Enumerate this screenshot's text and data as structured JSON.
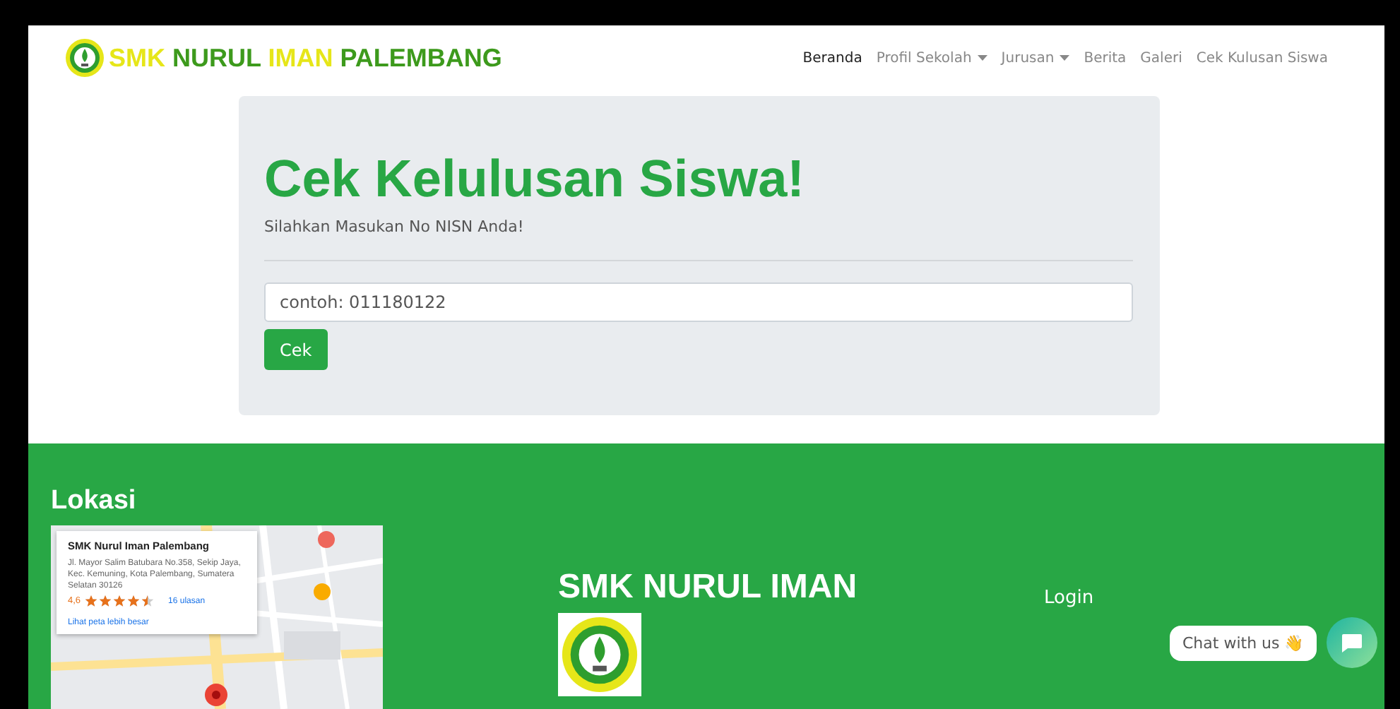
{
  "brand": {
    "parts": [
      {
        "text": "SMK",
        "color": "#e6e619"
      },
      {
        "text": "NURUL",
        "color": "#3d9a1c"
      },
      {
        "text": "IMAN",
        "color": "#e6e619"
      },
      {
        "text": "PALEMBANG",
        "color": "#3d9a1c"
      }
    ]
  },
  "nav": [
    {
      "label": "Beranda",
      "selected": true,
      "dropdown": false
    },
    {
      "label": "Profil Sekolah",
      "selected": false,
      "dropdown": true
    },
    {
      "label": "Jurusan",
      "selected": false,
      "dropdown": true
    },
    {
      "label": "Berita",
      "selected": false,
      "dropdown": false
    },
    {
      "label": "Galeri",
      "selected": false,
      "dropdown": false
    },
    {
      "label": "Cek Kulusan Siswa",
      "selected": false,
      "dropdown": false
    }
  ],
  "hero": {
    "title": "Cek Kelulusan Siswa!",
    "subtitle": "Silahkan Masukan No NISN Anda!",
    "input": {
      "placeholder": "contoh: 011180122"
    },
    "button": "Cek"
  },
  "footer": {
    "location_title": "Lokasi",
    "map_card": {
      "name": "SMK Nurul Iman Palembang",
      "address": "Jl. Mayor Salim Batubara No.358, Sekip Jaya, Kec. Kemuning, Kota Palembang, Sumatera Selatan 30126",
      "rating": "4,6",
      "stars": 4.5,
      "reviews": "16 ulasan",
      "link": "Lihat peta lebih besar"
    },
    "school_title": "SMK NURUL IMAN",
    "login": "Login"
  },
  "chat": {
    "label": "Chat with us 👋"
  }
}
